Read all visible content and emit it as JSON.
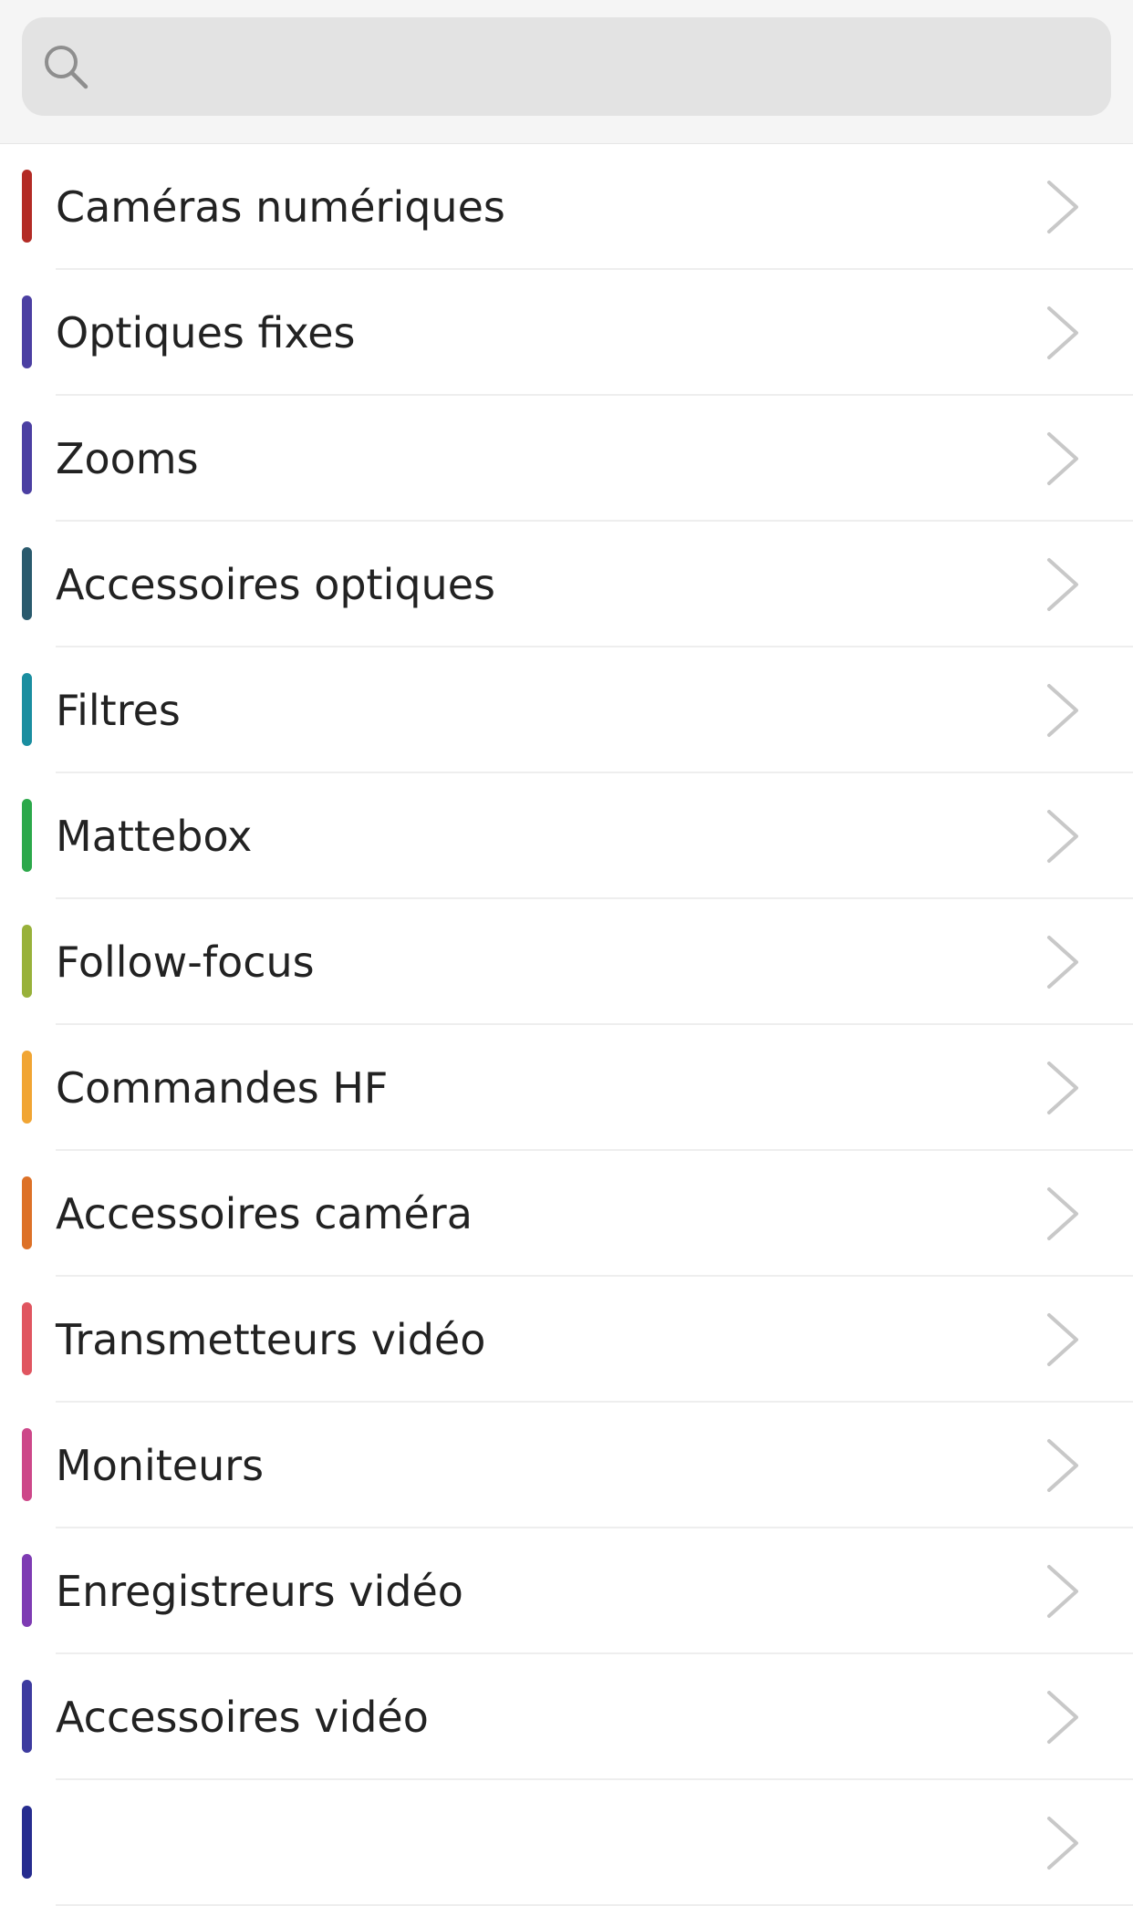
{
  "search": {
    "placeholder": "",
    "value": "",
    "icon": "search-icon"
  },
  "categories": [
    {
      "label": "Caméras numériques",
      "color": "#b32b25"
    },
    {
      "label": "Optiques fixes",
      "color": "#4b3fa2"
    },
    {
      "label": "Zooms",
      "color": "#4b3fa2"
    },
    {
      "label": "Accessoires optiques",
      "color": "#2a5a6d"
    },
    {
      "label": "Filtres",
      "color": "#1a8ea0"
    },
    {
      "label": "Mattebox",
      "color": "#2ba84a"
    },
    {
      "label": "Follow-focus",
      "color": "#98b13a"
    },
    {
      "label": "Commandes HF",
      "color": "#f1a533"
    },
    {
      "label": "Accessoires caméra",
      "color": "#dd7127"
    },
    {
      "label": "Transmetteurs vidéo",
      "color": "#e05560"
    },
    {
      "label": "Moniteurs",
      "color": "#cd4789"
    },
    {
      "label": "Enregistreurs vidéo",
      "color": "#7e3bb3"
    },
    {
      "label": "Accessoires vidéo",
      "color": "#3d3b9f"
    },
    {
      "label": "",
      "color": "#262c8f"
    }
  ],
  "row_icon": "chevron-right-icon"
}
